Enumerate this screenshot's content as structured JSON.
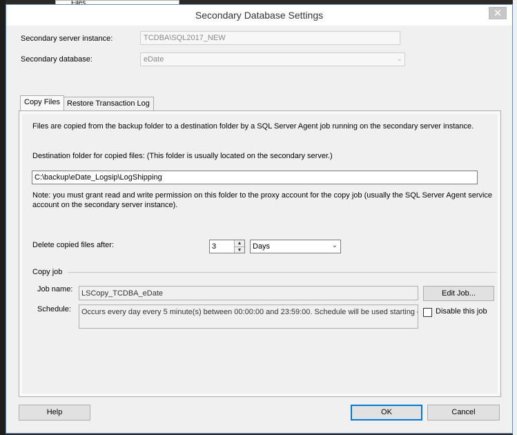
{
  "background": {
    "explorer_item": "Files"
  },
  "dialog": {
    "title": "Secondary Database Settings",
    "close_glyph": "✕"
  },
  "fields": {
    "server_label": "Secondary server instance:",
    "server_value": "TCDBA\\SQL2017_NEW",
    "database_label": "Secondary database:",
    "database_value": "eDate"
  },
  "tabs": [
    {
      "label": "Copy Files",
      "active": true
    },
    {
      "label": "Restore Transaction Log",
      "active": false
    }
  ],
  "copy_files": {
    "description": "Files are copied from the backup folder to a destination folder by a SQL Server Agent job running on the secondary server instance.",
    "dest_label": "Destination folder for copied files: (This folder is usually located on the secondary server.)",
    "dest_value": "C:\\backup\\eDate_Logsip\\LogShipping",
    "note_line1": "Note: you must grant read and write permission on this folder to the proxy account for the copy job (usually the SQL Server Agent service",
    "note_line2": "account on the secondary server instance).",
    "delete_label": "Delete copied files after:",
    "delete_value": "3",
    "delete_unit": "Days",
    "copy_job_group": "Copy job",
    "job_name_label": "Job name:",
    "job_name_value": "LSCopy_TCDBA_eDate",
    "edit_job_button": "Edit Job...",
    "schedule_label": "Schedule:",
    "schedule_value": "Occurs every day every 5 minute(s) between 00:00:00 and 23:59:00. Schedule will be used starting on",
    "disable_job_label": "Disable this job",
    "disable_job_checked": false
  },
  "footer": {
    "help_button": "Help",
    "ok_button": "OK",
    "cancel_button": "Cancel"
  },
  "colors": {
    "accent_border": "#0078d7",
    "dialog_bg": "#f0f0f0"
  }
}
